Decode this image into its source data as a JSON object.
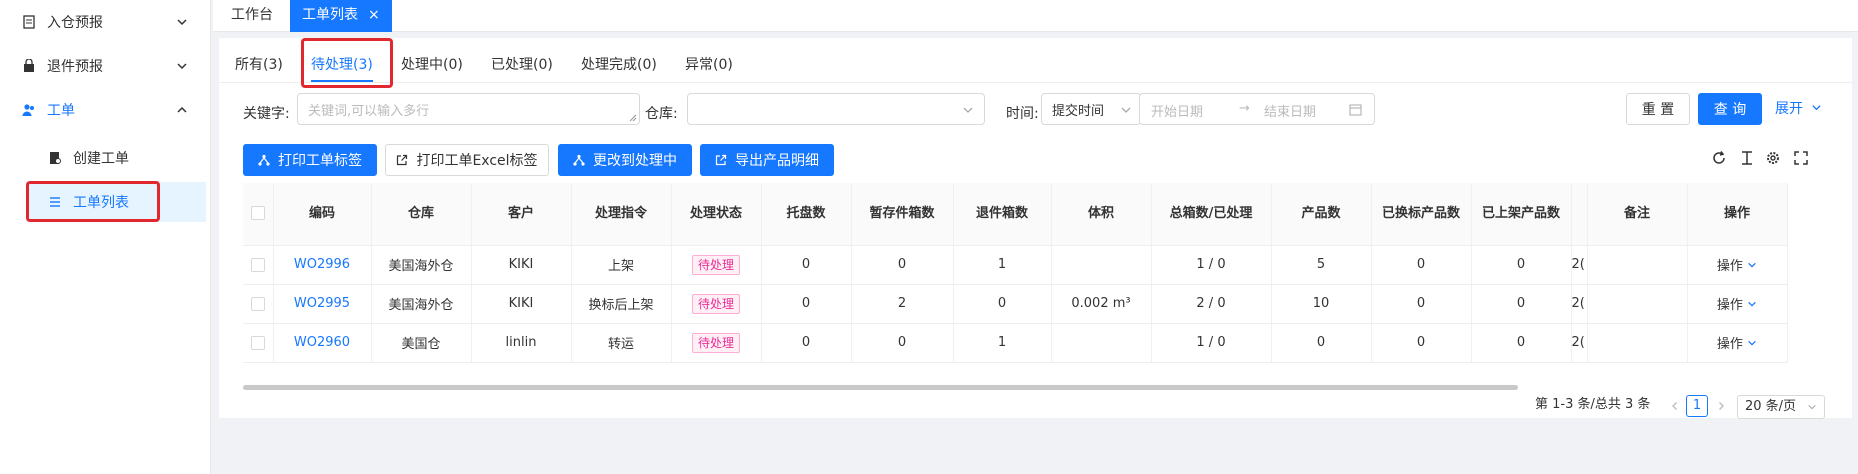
{
  "sidebar": {
    "items": [
      {
        "label": "入仓预报",
        "icon": "document-icon"
      },
      {
        "label": "退件预报",
        "icon": "bag-icon"
      },
      {
        "label": "工单",
        "icon": "users-icon"
      }
    ],
    "subitems": [
      {
        "label": "创建工单",
        "icon": "file-lock-icon"
      },
      {
        "label": "工单列表",
        "icon": "list-icon"
      }
    ]
  },
  "page_tabs": [
    {
      "label": "工作台"
    },
    {
      "label": "工单列表",
      "close": "×"
    }
  ],
  "status_tabs": [
    {
      "label": "所有(3)"
    },
    {
      "label": "待处理(3)"
    },
    {
      "label": "处理中(0)"
    },
    {
      "label": "已处理(0)"
    },
    {
      "label": "处理完成(0)"
    },
    {
      "label": "异常(0)"
    }
  ],
  "filters": {
    "keyword_label": "关键字:",
    "keyword_placeholder": "关键词,可以输入多行",
    "warehouse_label": "仓库:",
    "time_label": "时间:",
    "time_type": "提交时间",
    "start_placeholder": "开始日期",
    "arrow": "→",
    "end_placeholder": "结束日期",
    "reset": "重 置",
    "query": "查 询",
    "expand": "展开"
  },
  "actions": {
    "print_label": "打印工单标签",
    "print_excel": "打印工单Excel标签",
    "change_processing": "更改到处理中",
    "export_details": "导出产品明细"
  },
  "table": {
    "headers": [
      "编码",
      "仓库",
      "客户",
      "处理指令",
      "处理状态",
      "托盘数",
      "暂存件箱数",
      "退件箱数",
      "体积",
      "总箱数/已处理",
      "产品数",
      "已换标产品数",
      "已上架产品数",
      "备注",
      "操作"
    ],
    "rows": [
      {
        "code": "WO2996",
        "warehouse": "美国海外仓",
        "customer": "KIKI",
        "instruction": "上架",
        "status": "待处理",
        "pallets": "0",
        "temp_boxes": "0",
        "return_boxes": "1",
        "volume": "",
        "total_boxes": "1 / 0",
        "products": "5",
        "relabeled": "0",
        "shelved": "0",
        "remark": "",
        "op": "操作"
      },
      {
        "code": "WO2995",
        "warehouse": "美国海外仓",
        "customer": "KIKI",
        "instruction": "换标后上架",
        "status": "待处理",
        "pallets": "0",
        "temp_boxes": "2",
        "return_boxes": "0",
        "volume": "0.002 m³",
        "total_boxes": "2 / 0",
        "products": "10",
        "relabeled": "0",
        "shelved": "0",
        "remark": "",
        "op": "操作"
      },
      {
        "code": "WO2960",
        "warehouse": "美国仓",
        "customer": "linlin",
        "instruction": "转运",
        "status": "待处理",
        "pallets": "0",
        "temp_boxes": "0",
        "return_boxes": "1",
        "volume": "",
        "total_boxes": "1 / 0",
        "products": "0",
        "relabeled": "0",
        "shelved": "0",
        "remark": "",
        "op": "操作"
      }
    ],
    "partial_col_value": "2("
  },
  "pagination": {
    "summary": "第 1-3 条/总共 3 条",
    "current_page": "1",
    "page_size": "20 条/页"
  },
  "colors": {
    "accent": "#1677ff",
    "highlight": "#e0282e",
    "tag": "#eb2f96"
  }
}
